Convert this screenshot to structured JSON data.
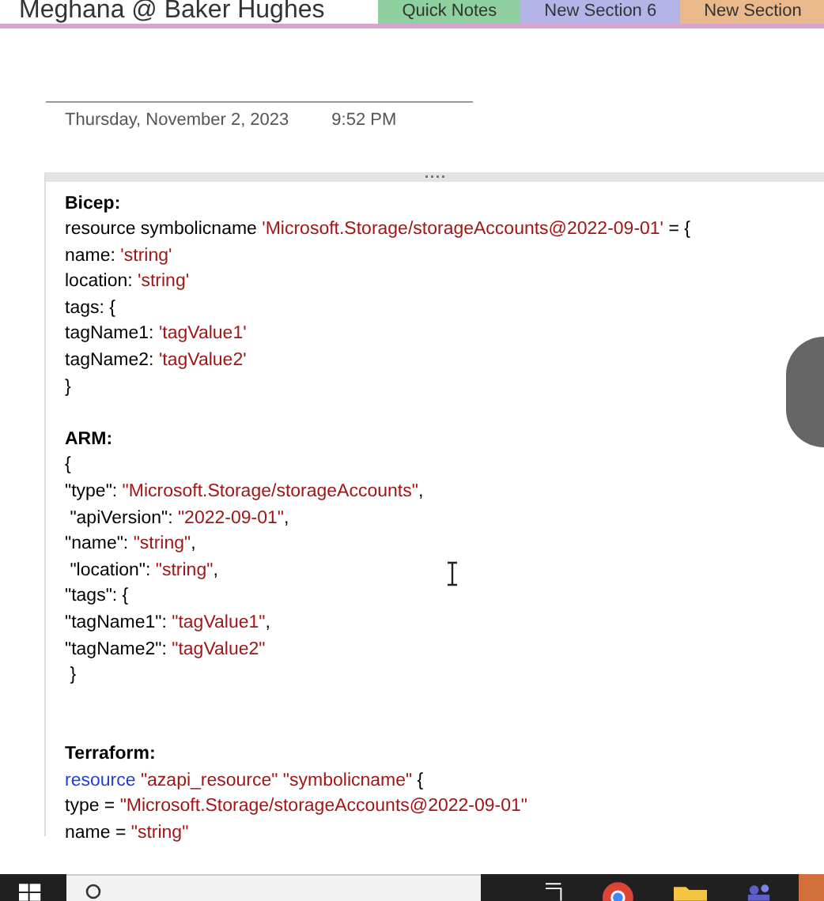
{
  "notebook": {
    "title": "Meghana @ Baker Hughes"
  },
  "section_tabs": [
    {
      "label": "Quick Notes",
      "color": "#8fd19e",
      "selected": false
    },
    {
      "label": "New Section 6",
      "color": "#b4b4e8",
      "selected": false
    },
    {
      "label": "New Section",
      "color": "#e9b98c",
      "selected": false
    }
  ],
  "page": {
    "date": "Thursday, November 2, 2023",
    "time": "9:52 PM"
  },
  "note_lines": [
    {
      "kind": "heading",
      "segments": [
        {
          "kind": "plain",
          "text": "Bicep:"
        }
      ]
    },
    {
      "kind": "code",
      "segments": [
        {
          "kind": "plain",
          "text": "resource symbolicname "
        },
        {
          "kind": "string",
          "text": "'Microsoft.Storage/storageAccounts@2022-09-01'"
        },
        {
          "kind": "plain",
          "text": " = {"
        }
      ]
    },
    {
      "kind": "code",
      "segments": [
        {
          "kind": "plain",
          "text": "name: "
        },
        {
          "kind": "string",
          "text": "'string'"
        }
      ]
    },
    {
      "kind": "code",
      "segments": [
        {
          "kind": "plain",
          "text": "location: "
        },
        {
          "kind": "string",
          "text": "'string'"
        }
      ]
    },
    {
      "kind": "code",
      "segments": [
        {
          "kind": "plain",
          "text": "tags: {"
        }
      ]
    },
    {
      "kind": "code",
      "segments": [
        {
          "kind": "plain",
          "text": "tagName1: "
        },
        {
          "kind": "string",
          "text": "'tagValue1'"
        }
      ]
    },
    {
      "kind": "code",
      "segments": [
        {
          "kind": "plain",
          "text": "tagName2: "
        },
        {
          "kind": "string",
          "text": "'tagValue2'"
        }
      ]
    },
    {
      "kind": "code",
      "segments": [
        {
          "kind": "plain",
          "text": "}"
        }
      ]
    },
    {
      "kind": "blank"
    },
    {
      "kind": "heading",
      "segments": [
        {
          "kind": "plain",
          "text": "ARM:"
        }
      ]
    },
    {
      "kind": "code",
      "segments": [
        {
          "kind": "plain",
          "text": "{"
        }
      ]
    },
    {
      "kind": "code",
      "segments": [
        {
          "kind": "plain",
          "text": "\"type\": "
        },
        {
          "kind": "string",
          "text": "\"Microsoft.Storage/storageAccounts\""
        },
        {
          "kind": "plain",
          "text": ","
        }
      ]
    },
    {
      "kind": "code",
      "segments": [
        {
          "kind": "plain",
          "text": " \"apiVersion\": "
        },
        {
          "kind": "string",
          "text": "\"2022-09-01\""
        },
        {
          "kind": "plain",
          "text": ","
        }
      ]
    },
    {
      "kind": "code",
      "segments": [
        {
          "kind": "plain",
          "text": "\"name\": "
        },
        {
          "kind": "string",
          "text": "\"string\""
        },
        {
          "kind": "plain",
          "text": ","
        }
      ]
    },
    {
      "kind": "code",
      "segments": [
        {
          "kind": "plain",
          "text": " \"location\": "
        },
        {
          "kind": "string",
          "text": "\"string\""
        },
        {
          "kind": "plain",
          "text": ","
        }
      ]
    },
    {
      "kind": "code",
      "segments": [
        {
          "kind": "plain",
          "text": "\"tags\": {"
        }
      ]
    },
    {
      "kind": "code",
      "segments": [
        {
          "kind": "plain",
          "text": "\"tagName1\": "
        },
        {
          "kind": "string",
          "text": "\"tagValue1\""
        },
        {
          "kind": "plain",
          "text": ","
        }
      ]
    },
    {
      "kind": "code",
      "segments": [
        {
          "kind": "plain",
          "text": "\"tagName2\": "
        },
        {
          "kind": "string",
          "text": "\"tagValue2\""
        }
      ]
    },
    {
      "kind": "code",
      "segments": [
        {
          "kind": "plain",
          "text": " }"
        }
      ]
    },
    {
      "kind": "blank"
    },
    {
      "kind": "blank"
    },
    {
      "kind": "heading",
      "segments": [
        {
          "kind": "plain",
          "text": "Terraform:"
        }
      ]
    },
    {
      "kind": "code",
      "segments": [
        {
          "kind": "keyword",
          "text": "resource"
        },
        {
          "kind": "string",
          "text": " \"azapi_resource\" \"symbolicname\""
        },
        {
          "kind": "plain",
          "text": " {"
        }
      ]
    },
    {
      "kind": "code",
      "segments": [
        {
          "kind": "plain",
          "text": "type = "
        },
        {
          "kind": "string",
          "text": "\"Microsoft.Storage/storageAccounts@2022-09-01\""
        }
      ]
    },
    {
      "kind": "code",
      "segments": [
        {
          "kind": "plain",
          "text": "name = "
        },
        {
          "kind": "string",
          "text": "\"string\""
        }
      ]
    }
  ]
}
